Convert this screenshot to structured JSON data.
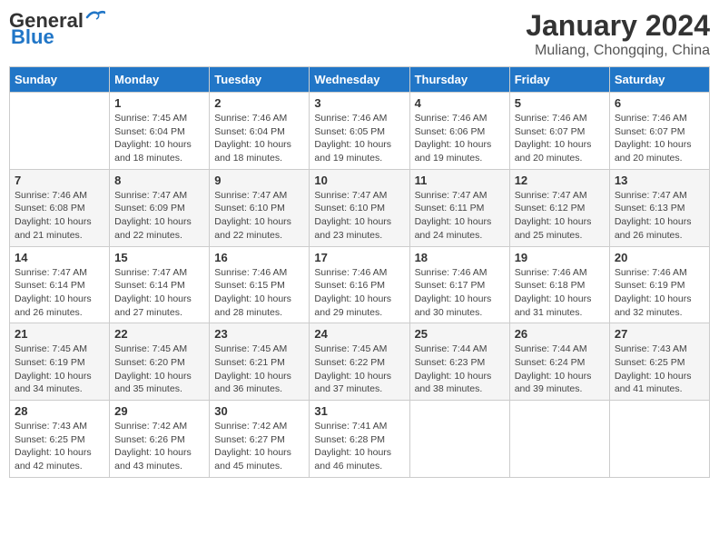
{
  "header": {
    "logo_general": "General",
    "logo_blue": "Blue",
    "title": "January 2024",
    "subtitle": "Muliang, Chongqing, China"
  },
  "weekdays": [
    "Sunday",
    "Monday",
    "Tuesday",
    "Wednesday",
    "Thursday",
    "Friday",
    "Saturday"
  ],
  "weeks": [
    [
      {
        "day": "",
        "info": ""
      },
      {
        "day": "1",
        "info": "Sunrise: 7:45 AM\nSunset: 6:04 PM\nDaylight: 10 hours\nand 18 minutes."
      },
      {
        "day": "2",
        "info": "Sunrise: 7:46 AM\nSunset: 6:04 PM\nDaylight: 10 hours\nand 18 minutes."
      },
      {
        "day": "3",
        "info": "Sunrise: 7:46 AM\nSunset: 6:05 PM\nDaylight: 10 hours\nand 19 minutes."
      },
      {
        "day": "4",
        "info": "Sunrise: 7:46 AM\nSunset: 6:06 PM\nDaylight: 10 hours\nand 19 minutes."
      },
      {
        "day": "5",
        "info": "Sunrise: 7:46 AM\nSunset: 6:07 PM\nDaylight: 10 hours\nand 20 minutes."
      },
      {
        "day": "6",
        "info": "Sunrise: 7:46 AM\nSunset: 6:07 PM\nDaylight: 10 hours\nand 20 minutes."
      }
    ],
    [
      {
        "day": "7",
        "info": "Sunrise: 7:46 AM\nSunset: 6:08 PM\nDaylight: 10 hours\nand 21 minutes."
      },
      {
        "day": "8",
        "info": "Sunrise: 7:47 AM\nSunset: 6:09 PM\nDaylight: 10 hours\nand 22 minutes."
      },
      {
        "day": "9",
        "info": "Sunrise: 7:47 AM\nSunset: 6:10 PM\nDaylight: 10 hours\nand 22 minutes."
      },
      {
        "day": "10",
        "info": "Sunrise: 7:47 AM\nSunset: 6:10 PM\nDaylight: 10 hours\nand 23 minutes."
      },
      {
        "day": "11",
        "info": "Sunrise: 7:47 AM\nSunset: 6:11 PM\nDaylight: 10 hours\nand 24 minutes."
      },
      {
        "day": "12",
        "info": "Sunrise: 7:47 AM\nSunset: 6:12 PM\nDaylight: 10 hours\nand 25 minutes."
      },
      {
        "day": "13",
        "info": "Sunrise: 7:47 AM\nSunset: 6:13 PM\nDaylight: 10 hours\nand 26 minutes."
      }
    ],
    [
      {
        "day": "14",
        "info": "Sunrise: 7:47 AM\nSunset: 6:14 PM\nDaylight: 10 hours\nand 26 minutes."
      },
      {
        "day": "15",
        "info": "Sunrise: 7:47 AM\nSunset: 6:14 PM\nDaylight: 10 hours\nand 27 minutes."
      },
      {
        "day": "16",
        "info": "Sunrise: 7:46 AM\nSunset: 6:15 PM\nDaylight: 10 hours\nand 28 minutes."
      },
      {
        "day": "17",
        "info": "Sunrise: 7:46 AM\nSunset: 6:16 PM\nDaylight: 10 hours\nand 29 minutes."
      },
      {
        "day": "18",
        "info": "Sunrise: 7:46 AM\nSunset: 6:17 PM\nDaylight: 10 hours\nand 30 minutes."
      },
      {
        "day": "19",
        "info": "Sunrise: 7:46 AM\nSunset: 6:18 PM\nDaylight: 10 hours\nand 31 minutes."
      },
      {
        "day": "20",
        "info": "Sunrise: 7:46 AM\nSunset: 6:19 PM\nDaylight: 10 hours\nand 32 minutes."
      }
    ],
    [
      {
        "day": "21",
        "info": "Sunrise: 7:45 AM\nSunset: 6:19 PM\nDaylight: 10 hours\nand 34 minutes."
      },
      {
        "day": "22",
        "info": "Sunrise: 7:45 AM\nSunset: 6:20 PM\nDaylight: 10 hours\nand 35 minutes."
      },
      {
        "day": "23",
        "info": "Sunrise: 7:45 AM\nSunset: 6:21 PM\nDaylight: 10 hours\nand 36 minutes."
      },
      {
        "day": "24",
        "info": "Sunrise: 7:45 AM\nSunset: 6:22 PM\nDaylight: 10 hours\nand 37 minutes."
      },
      {
        "day": "25",
        "info": "Sunrise: 7:44 AM\nSunset: 6:23 PM\nDaylight: 10 hours\nand 38 minutes."
      },
      {
        "day": "26",
        "info": "Sunrise: 7:44 AM\nSunset: 6:24 PM\nDaylight: 10 hours\nand 39 minutes."
      },
      {
        "day": "27",
        "info": "Sunrise: 7:43 AM\nSunset: 6:25 PM\nDaylight: 10 hours\nand 41 minutes."
      }
    ],
    [
      {
        "day": "28",
        "info": "Sunrise: 7:43 AM\nSunset: 6:25 PM\nDaylight: 10 hours\nand 42 minutes."
      },
      {
        "day": "29",
        "info": "Sunrise: 7:42 AM\nSunset: 6:26 PM\nDaylight: 10 hours\nand 43 minutes."
      },
      {
        "day": "30",
        "info": "Sunrise: 7:42 AM\nSunset: 6:27 PM\nDaylight: 10 hours\nand 45 minutes."
      },
      {
        "day": "31",
        "info": "Sunrise: 7:41 AM\nSunset: 6:28 PM\nDaylight: 10 hours\nand 46 minutes."
      },
      {
        "day": "",
        "info": ""
      },
      {
        "day": "",
        "info": ""
      },
      {
        "day": "",
        "info": ""
      }
    ]
  ]
}
